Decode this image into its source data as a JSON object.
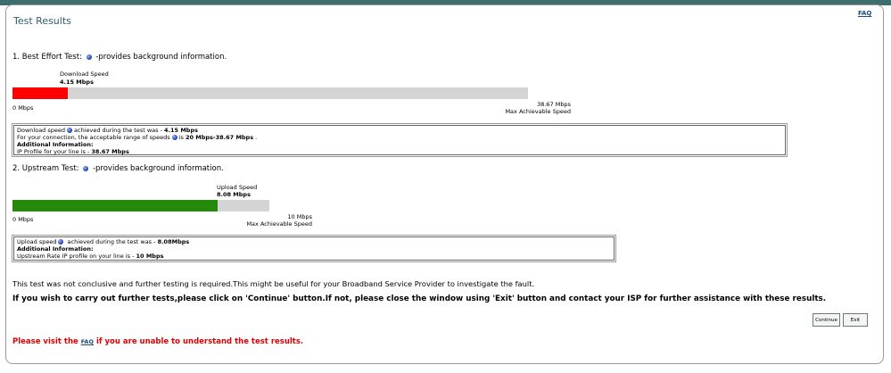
{
  "header": {
    "title": "Test Results",
    "faq_label": "FAQ"
  },
  "best_effort": {
    "heading_prefix": "1. Best Effort Test:",
    "heading_suffix": "-provides background information.",
    "download_label": "Download Speed",
    "download_value": "4.15 Mbps",
    "measured_fraction": 0.107,
    "scale_min": "0 Mbps",
    "scale_max": "38.67 Mbps",
    "scale_max_caption": "Max Achievable Speed",
    "details": {
      "line1_prefix": "Download speed",
      "line1_mid": "achieved during the test was - ",
      "line1_value": "4.15 Mbps",
      "line2_prefix": "For your connection, the acceptable range of speeds",
      "line2_mid": "is ",
      "line2_value": "20 Mbps-38.67 Mbps",
      "line2_end": " .",
      "additional_heading": "Additional Information:",
      "line4_prefix": "IP Profile for your line is - ",
      "line4_value": "38.67 Mbps"
    },
    "bar_color": "#ff0000"
  },
  "upstream": {
    "heading_prefix": "2. Upstream Test:",
    "heading_suffix": "-provides background information.",
    "upload_label": "Upload Speed",
    "upload_value": "8.08 Mbps",
    "measured_fraction": 0.8,
    "scale_min": "0 Mbps",
    "scale_max": "10 Mbps",
    "scale_max_caption": "Max Achievable Speed",
    "details": {
      "line1_prefix": "Upload speed",
      "line1_mid": " achieved during the test was - ",
      "line1_value": "8.08Mbps",
      "additional_heading": "Additional Information:",
      "line3_prefix": "Upstream Rate IP profile on your line is - ",
      "line3_value": "10 Mbps"
    },
    "bar_color": "#258a0c"
  },
  "messages": {
    "inconclusive": "This test was not conclusive and further testing is required.This might be useful for your Broadband Service Provider to investigate the fault.",
    "instruction": "If you wish to carry out further tests,please click on 'Continue' button.If not, please close the window using 'Exit' button and contact your ISP for further assistance with these results."
  },
  "buttons": {
    "continue_label": "Continue",
    "exit_label": "Exit"
  },
  "footer": {
    "visit_prefix": "Please visit the ",
    "faq_link": "FAQ",
    "visit_suffix": " if you are unable to understand the test results."
  }
}
